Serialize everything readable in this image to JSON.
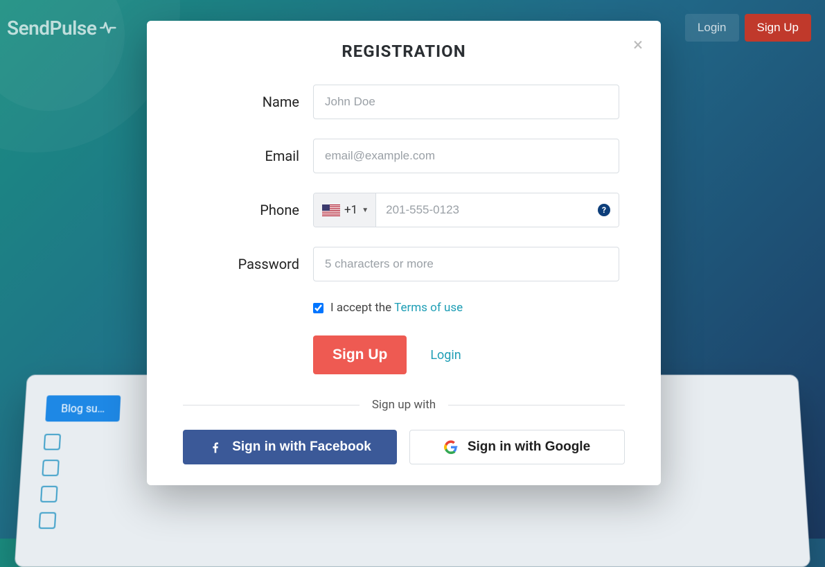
{
  "brand": "SendPulse",
  "header": {
    "login": "Login",
    "signup": "Sign Up"
  },
  "modal": {
    "title": "REGISTRATION",
    "fields": {
      "name": {
        "label": "Name",
        "placeholder": "John Doe",
        "value": ""
      },
      "email": {
        "label": "Email",
        "placeholder": "email@example.com",
        "value": ""
      },
      "phone": {
        "label": "Phone",
        "prefix": "+1",
        "placeholder": "201-555-0123",
        "value": ""
      },
      "password": {
        "label": "Password",
        "placeholder": "5 characters or more",
        "value": ""
      }
    },
    "terms": {
      "text": "I accept the ",
      "link": "Terms of use",
      "checked": true
    },
    "actions": {
      "signup": "Sign Up",
      "login": "Login"
    },
    "social": {
      "divider": "Sign up with",
      "facebook": "Sign in with Facebook",
      "google": "Sign in with Google"
    }
  },
  "colors": {
    "accent": "#ee5a52",
    "link": "#1e9eb5",
    "facebook": "#3b5998",
    "header_signup": "#c0392b"
  }
}
